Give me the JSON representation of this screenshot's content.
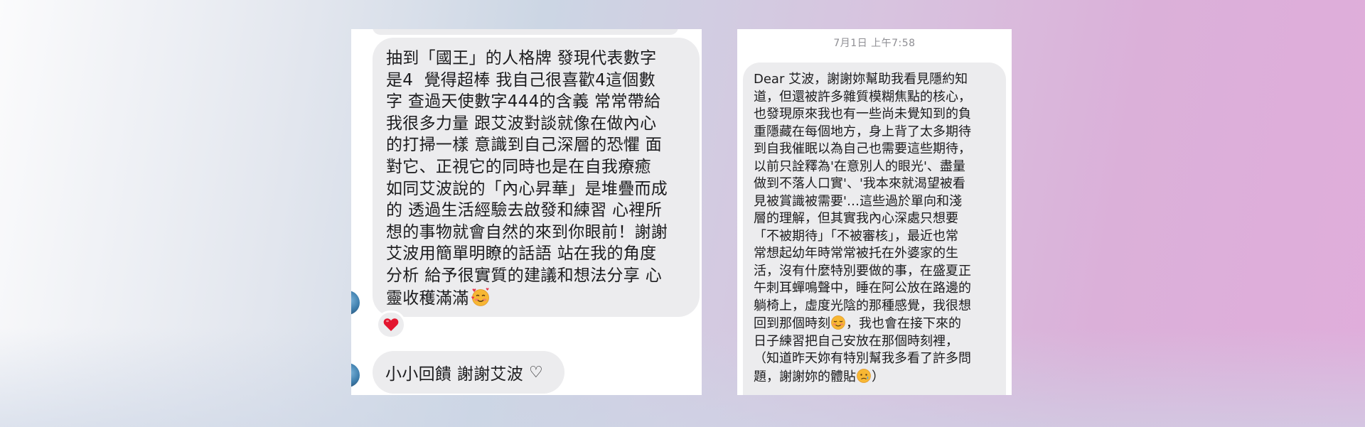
{
  "left_chat": {
    "main_message_lines": [
      "抽到「國王」的人格牌 發現代表數字",
      "是4  覺得超棒 我自己很喜歡4這個數",
      "字 查過天使數字444的含義 常常帶給",
      "我很多力量 跟艾波對談就像在做內心",
      "的打掃一樣 意識到自己深層的恐懼 面",
      "對它、正視它的同時也是在自我療癒",
      "如同艾波說的「內心昇華」是堆疊而成",
      "的 透過生活經驗去啟發和練習 心裡所",
      "想的事物就會自然的來到你眼前！謝謝",
      "艾波用簡單明瞭的話語 站在我的角度",
      "分析 給予很實質的建議和想法分享 心",
      "靈收穫滿滿"
    ],
    "main_message_emoji": "smiling-face-with-hearts-icon",
    "reaction": "red-heart-icon",
    "second_message": "小小回饋 謝謝艾波",
    "second_message_icon": "white-heart-icon"
  },
  "right_chat": {
    "timestamp": "7月1日 上午7:58",
    "message_lines": [
      "Dear 艾波，謝謝妳幫助我看見隱約知",
      "道，但還被許多雜質模糊焦點的核心，",
      "也發現原來我也有一些尚未覺知到的負",
      "重隱藏在每個地方，身上背了太多期待",
      "到自我催眠以為自己也需要這些期待，",
      "以前只詮釋為'在意別人的眼光'、盡量",
      "做到不落人口實'、'我本來就渴望被看",
      "見被賞識被需要'…這些過於單向和淺",
      "層的理解，但其實我內心深處只想要",
      "「不被期待」「不被審核」，最近也常",
      "常想起幼年時常常被托在外婆家的生",
      "活，沒有什麼特別要做的事，在盛夏正",
      "午刺耳蟬鳴聲中，睡在阿公放在路邊的",
      "躺椅上，虛度光陰的那種感覺，我很想",
      "回到那個時刻",
      "，我也會在接下來的",
      "日子練習把自己安放在那個時刻裡，",
      "（知道昨天妳有特別幫我多看了許多問",
      "題，謝謝妳的體貼",
      "）"
    ],
    "emoji_1": "relieved-smiling-face-icon",
    "emoji_2": "sad-but-relieved-face-icon"
  }
}
